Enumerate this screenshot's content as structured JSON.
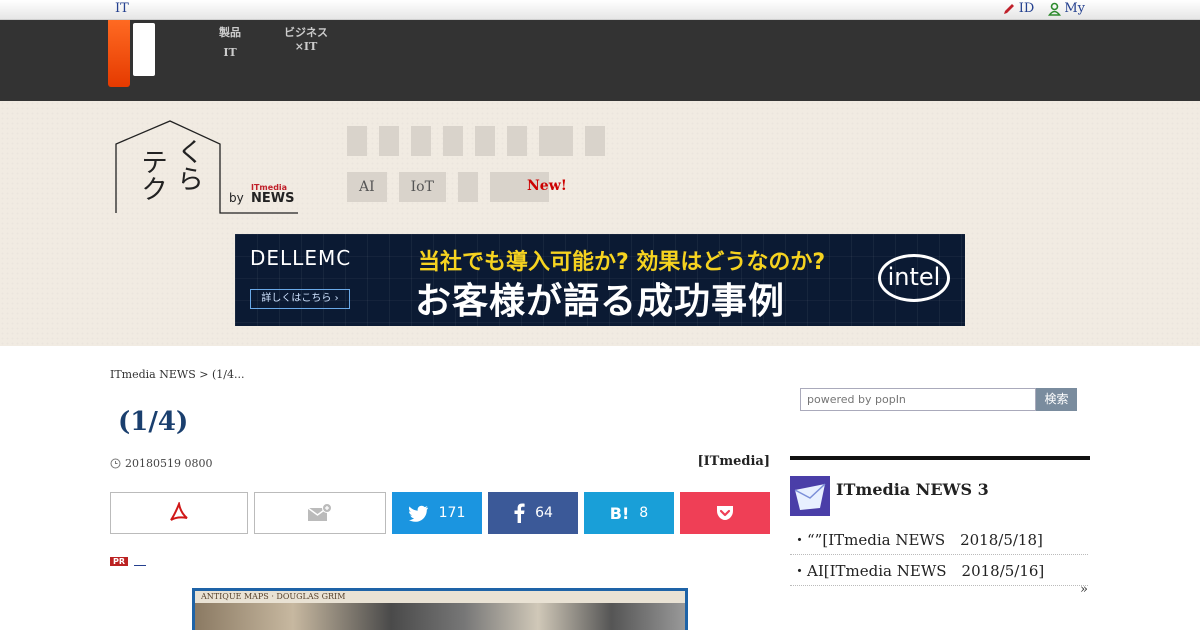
{
  "topbar": {
    "it_link": "IT",
    "id_link": "ID",
    "my_link": "My"
  },
  "nav": [
    {
      "line1": "製品",
      "line2": "IT"
    },
    {
      "line1": "ビジネス",
      "line2": "×IT"
    }
  ],
  "brand": {
    "logo_kana_1": "くら",
    "logo_kana_2": "テク",
    "by": "by",
    "itmedia": "ITmedia",
    "news": "NEWS"
  },
  "category_tags": [
    "AI",
    "IoT"
  ],
  "new_label": "New!",
  "ad": {
    "brand": "DELLEMC",
    "more_button": "詳しくはこちら ›",
    "line1": "当社でも導入可能か? 効果はどうなのか?",
    "line2": "お客様が語る成功事例",
    "partner": "intel"
  },
  "breadcrumb": {
    "home": "ITmedia NEWS",
    "separator": ">",
    "current": "(1/4..."
  },
  "article": {
    "title": "(1/4)",
    "date": "20180519 0800",
    "author": "[ITmedia]"
  },
  "share": {
    "twitter_count": "171",
    "facebook_count": "64",
    "hatena_label": "B!",
    "hatena_count": "8"
  },
  "pr_label": "PR",
  "photo_caption": "ANTIQUE MAPS · DOUGLAS GRIM",
  "search": {
    "placeholder": "powered by popIn",
    "button": "検索"
  },
  "ranking": {
    "title": "ITmedia NEWS 3",
    "items": [
      "・“”[ITmedia NEWS　2018/5/18]",
      "・AI[ITmedia NEWS　2018/5/16]"
    ],
    "more": "»"
  },
  "colors": {
    "accent_orange": "#ff6a22",
    "twitter": "#1b95e0",
    "facebook": "#3b5998",
    "hatena": "#199fd8",
    "pocket": "#ef3f56",
    "title_blue": "#1a3f6e"
  }
}
